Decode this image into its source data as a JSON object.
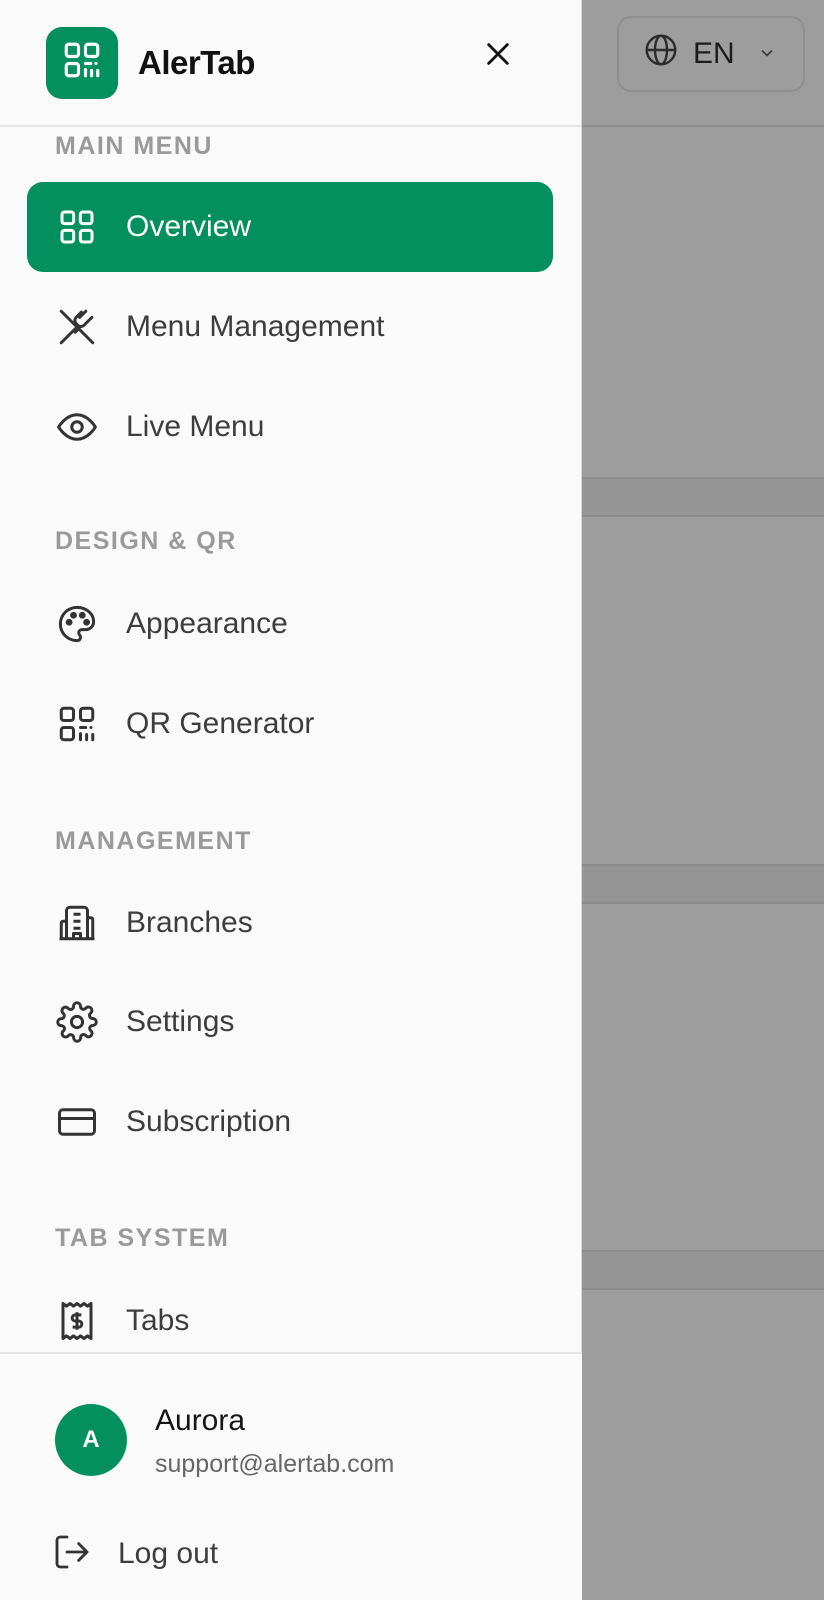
{
  "brand": {
    "name": "AlerTab",
    "logo_icon": "qr-code-icon"
  },
  "header": {
    "close_icon": "close-icon",
    "language": {
      "icon": "globe-icon",
      "value": "EN"
    }
  },
  "colors": {
    "accent": "#038f5e",
    "overlay": "#9d9d9d",
    "drawer_bg": "#fafafa"
  },
  "sections": {
    "main": "MAIN MENU",
    "design": "DESIGN & QR",
    "management": "MANAGEMENT",
    "tab_system": "TAB SYSTEM"
  },
  "nav": {
    "overview": {
      "label": "Overview",
      "icon": "grid-icon",
      "active": true
    },
    "menu_management": {
      "label": "Menu Management",
      "icon": "utensils-icon"
    },
    "live_menu": {
      "label": "Live Menu",
      "icon": "eye-icon"
    },
    "appearance": {
      "label": "Appearance",
      "icon": "palette-icon"
    },
    "qr_generator": {
      "label": "QR Generator",
      "icon": "qr-code-icon"
    },
    "branches": {
      "label": "Branches",
      "icon": "building-icon"
    },
    "settings": {
      "label": "Settings",
      "icon": "gear-icon"
    },
    "subscription": {
      "label": "Subscription",
      "icon": "credit-card-icon"
    },
    "tabs": {
      "label": "Tabs",
      "icon": "receipt-icon"
    }
  },
  "user": {
    "initial": "A",
    "name": "Aurora",
    "email": "support@alertab.com"
  },
  "logout": {
    "label": "Log out",
    "icon": "logout-icon"
  }
}
